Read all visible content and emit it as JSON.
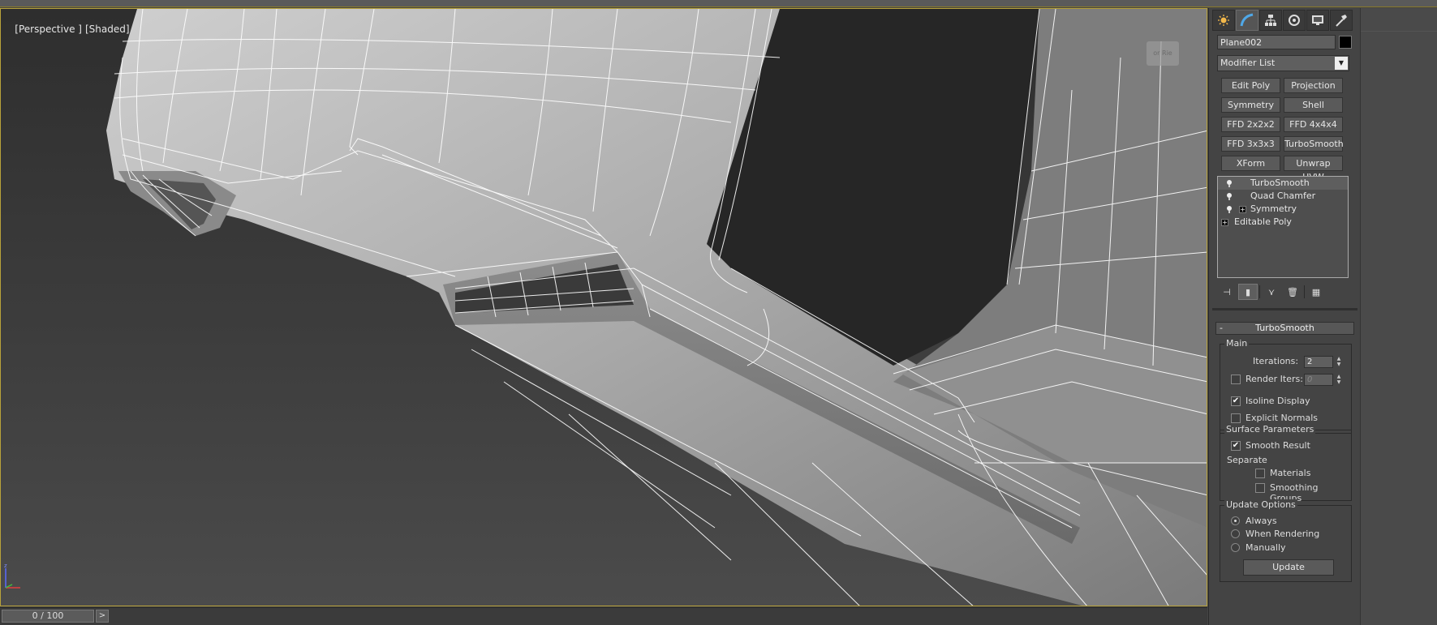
{
  "viewport": {
    "label_parts": [
      "[Perspective ]",
      "[Shaded]"
    ],
    "viewcube_text": "or Rie"
  },
  "timeline": {
    "position": "0 / 100",
    "next": ">"
  },
  "command_panel": {
    "tabs": [
      {
        "name": "create",
        "icon": "sun-icon"
      },
      {
        "name": "modify",
        "icon": "modify-curve-icon"
      },
      {
        "name": "hierarchy",
        "icon": "hierarchy-icon"
      },
      {
        "name": "motion",
        "icon": "motion-icon"
      },
      {
        "name": "display",
        "icon": "display-monitor-icon"
      },
      {
        "name": "utilities",
        "icon": "hammer-icon"
      }
    ],
    "object_name": "Plane002",
    "object_color": "#000000",
    "modifier_list": "Modifier List",
    "modifier_buttons": [
      "Edit Poly",
      "Projection",
      "Symmetry",
      "Shell",
      "FFD 2x2x2",
      "FFD 4x4x4",
      "FFD 3x3x3",
      "TurboSmooth",
      "XForm",
      "Unwrap UVW"
    ],
    "stack": [
      {
        "label": "TurboSmooth",
        "selected": true
      },
      {
        "label": "Quad Chamfer",
        "selected": false
      },
      {
        "label": "Symmetry",
        "selected": false
      },
      {
        "label": "Editable Poly",
        "selected": false
      }
    ],
    "turbosmooth": {
      "rollout_minus": "-",
      "title": "TurboSmooth",
      "main_label": "Main",
      "iterations_label": "Iterations:",
      "iterations_value": "2",
      "render_iters_label": "Render Iters:",
      "render_iters_value": "0",
      "render_iters_checked": false,
      "isoline_label": "Isoline Display",
      "isoline_checked": true,
      "explicit_normals_label": "Explicit Normals",
      "explicit_normals_checked": false,
      "surface_params_label": "Surface Parameters",
      "smooth_result_label": "Smooth Result",
      "smooth_result_checked": true,
      "separate_label": "Separate",
      "materials_label": "Materials",
      "smoothing_groups_label": "Smoothing Groups",
      "update_options_label": "Update Options",
      "update_options": [
        "Always",
        "When Rendering",
        "Manually"
      ],
      "update_selected": "Always",
      "update_button": "Update"
    }
  }
}
